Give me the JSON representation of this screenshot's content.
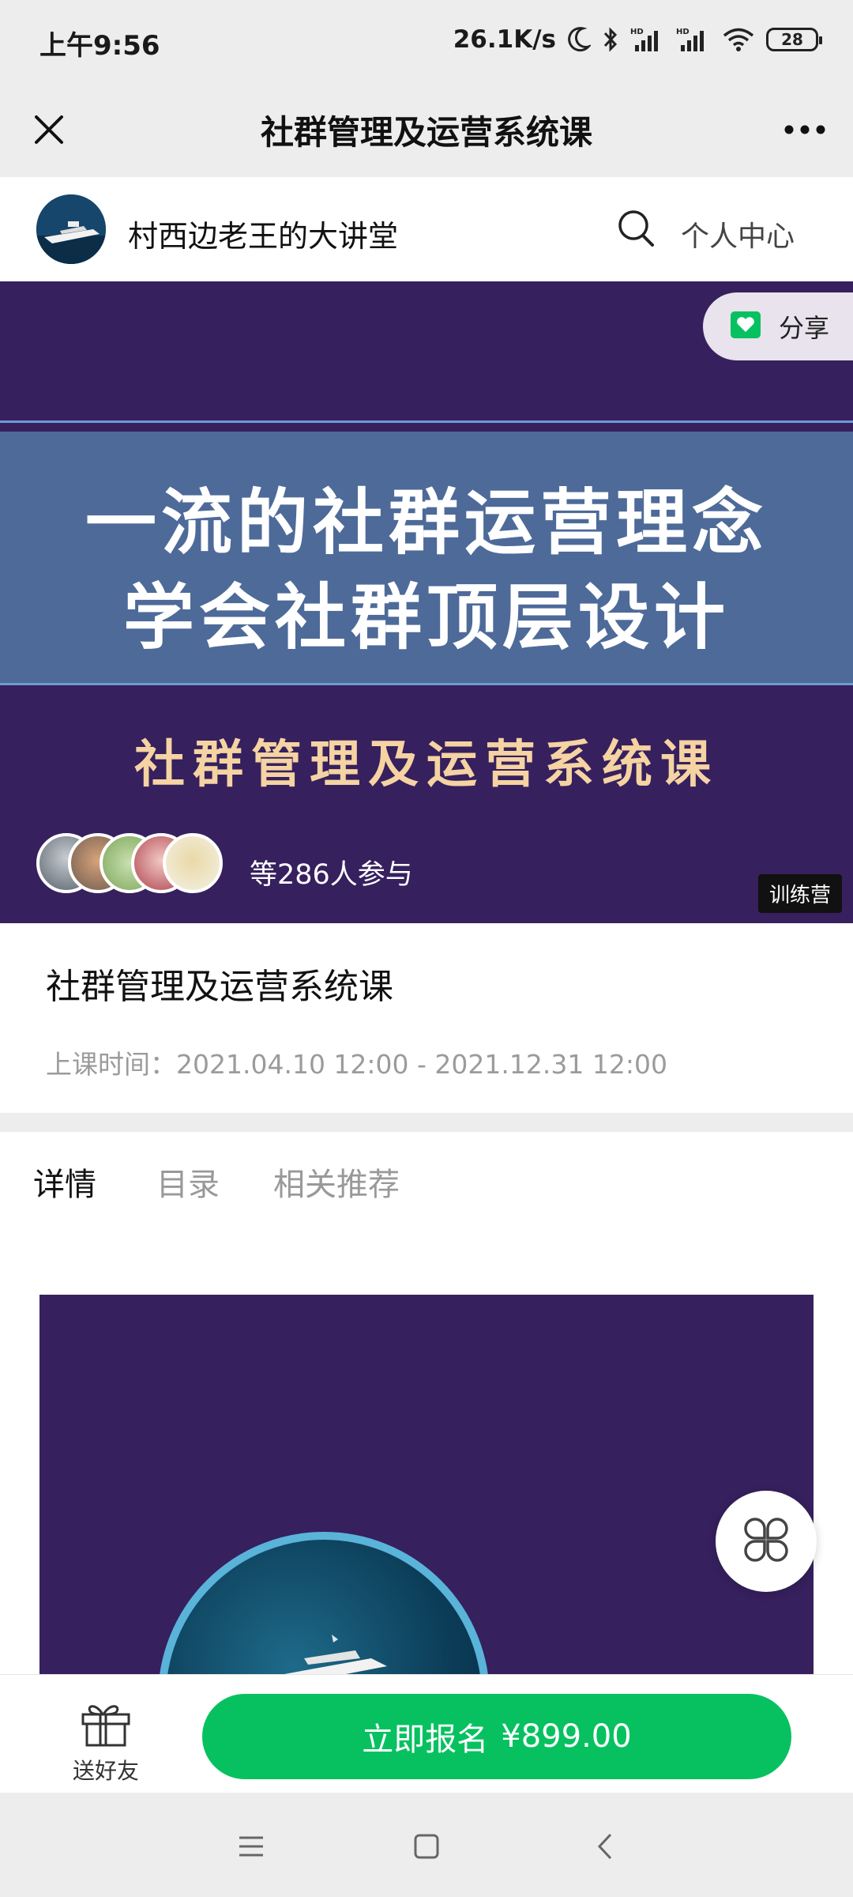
{
  "status_bar": {
    "time": "上午9:56",
    "speed": "26.1K/s",
    "battery": "28"
  },
  "nav": {
    "title": "社群管理及运营系统课"
  },
  "shop": {
    "name": "村西边老王的大讲堂",
    "personal_center": "个人中心"
  },
  "banner": {
    "headline_line1": "一流的社群运营理念",
    "headline_line2": "学会社群顶层设计",
    "subtitle": "社群管理及运营系统课",
    "share_label": "分享",
    "participants": "等286人参与",
    "badge": "训练营"
  },
  "course": {
    "title": "社群管理及运营系统课",
    "time_label": "上课时间：",
    "time_value": "2021.04.10 12:00 - 2021.12.31 12:00"
  },
  "tabs": [
    {
      "label": "详情",
      "active": true
    },
    {
      "label": "目录",
      "active": false
    },
    {
      "label": "相关推荐",
      "active": false
    }
  ],
  "action": {
    "gift_label": "送好友",
    "enroll_label": "立即报名",
    "price": "¥899.00"
  },
  "colors": {
    "accent_green": "#07c160",
    "tab_indicator": "#21b535",
    "banner_bg": "#36205e",
    "banner_band": "#4d6a99",
    "banner_subtitle": "#f5d3a2"
  },
  "icons": [
    "close-icon",
    "more-icon",
    "search-icon",
    "share-heart-icon",
    "gift-icon",
    "clover-menu-icon",
    "moon-icon",
    "bluetooth-icon",
    "signal-icon",
    "wifi-icon",
    "battery-icon"
  ]
}
